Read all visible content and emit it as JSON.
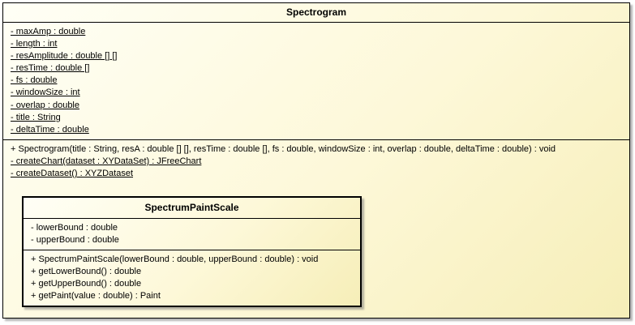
{
  "outer_class": {
    "name": "Spectrogram",
    "attributes": [
      {
        "text": "- maxAmp : double",
        "static": true
      },
      {
        "text": "- length : int",
        "static": true
      },
      {
        "text": "- resAmplitude : double [] []",
        "static": true
      },
      {
        "text": "- resTime : double []",
        "static": true
      },
      {
        "text": "- fs : double",
        "static": true
      },
      {
        "text": "- windowSize : int",
        "static": true
      },
      {
        "text": "- overlap : double",
        "static": true
      },
      {
        "text": "- title : String",
        "static": true
      },
      {
        "text": "- deltaTime : double",
        "static": true
      }
    ],
    "operations": [
      {
        "text": "+ Spectrogram(title : String, resA : double [] [], resTime : double [], fs : double, windowSize : int, overlap : double, deltaTime : double) : void",
        "static": false
      },
      {
        "text": "- createChart(dataset : XYDataSet) : JFreeChart",
        "static": true
      },
      {
        "text": "- createDataset() : XYZDataset",
        "static": true
      }
    ]
  },
  "inner_class": {
    "name": "SpectrumPaintScale",
    "attributes": [
      {
        "text": "- lowerBound : double",
        "static": false
      },
      {
        "text": "- upperBound : double",
        "static": false
      }
    ],
    "operations": [
      {
        "text": "+ SpectrumPaintScale(lowerBound : double, upperBound : double) : void",
        "static": false
      },
      {
        "text": "+ getLowerBound() : double",
        "static": false
      },
      {
        "text": "+ getUpperBound() : double",
        "static": false
      },
      {
        "text": "+ getPaint(value : double) : Paint",
        "static": false
      }
    ]
  }
}
